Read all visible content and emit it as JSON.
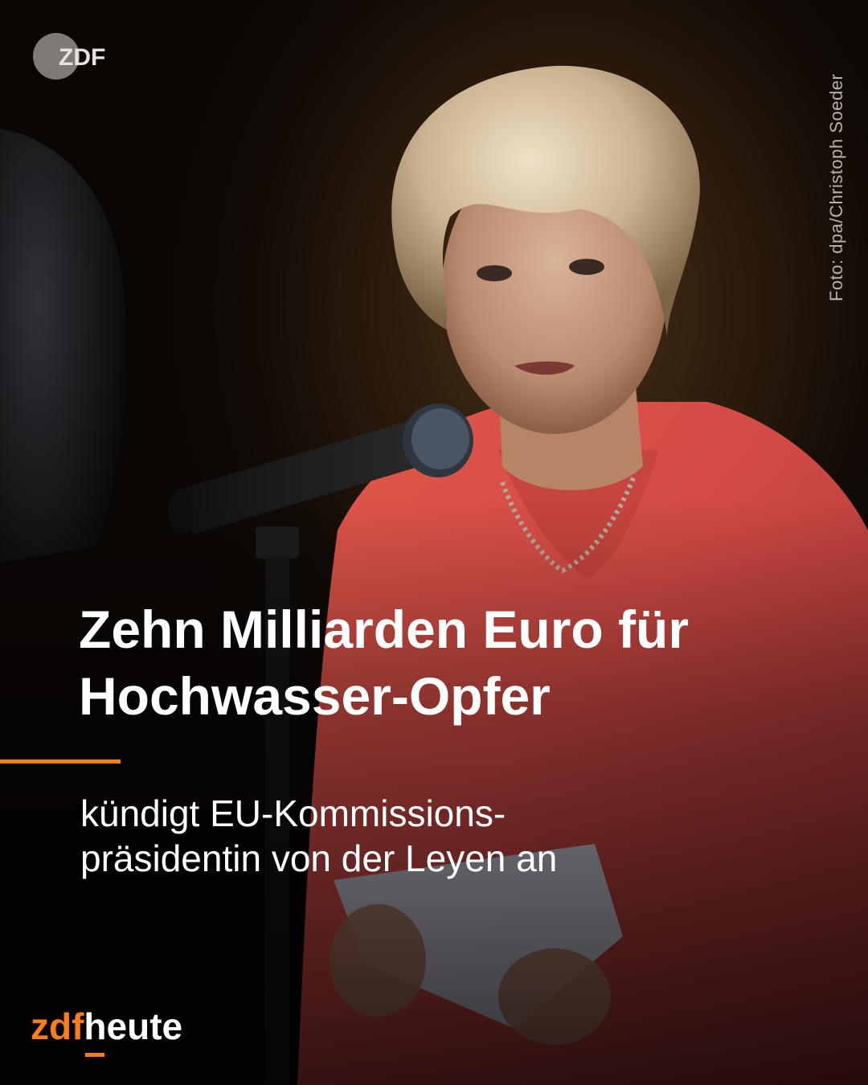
{
  "logo": {
    "text": "ZDF",
    "icon": "zdf-logo-icon"
  },
  "photo_credit": "Foto: dpa/Christoph Soeder",
  "headline": {
    "line1": "Zehn Milliarden Euro für",
    "line2": "Hochwasser-Opfer"
  },
  "subline": {
    "line1": "kündigt EU-Kommissions-",
    "line2": "präsidentin von der Leyen an"
  },
  "brand": {
    "zdf": "zdf",
    "heute": "heute"
  },
  "colors": {
    "accent": "#fa7d19",
    "text": "#ffffff",
    "background": "#0b0705"
  }
}
